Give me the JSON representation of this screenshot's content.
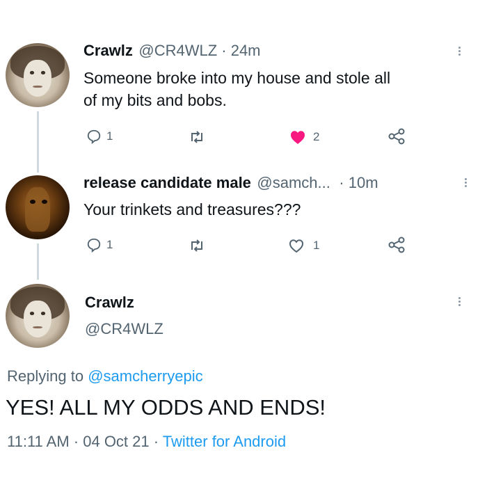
{
  "tweet1": {
    "name": "Crawlz",
    "handle_time": "@CR4WLZ · 24m",
    "text_line1": "Someone broke into my house and stole all",
    "text_line2": "of my bits and bobs.",
    "reply_count": "1",
    "like_count": "2",
    "liked": true
  },
  "tweet2": {
    "name": "release candidate male",
    "handle": "@samch...",
    "time": "· 10m",
    "text": "Your trinkets and treasures???",
    "reply_count": "1",
    "like_count": "1",
    "liked": false
  },
  "main_tweet": {
    "name": "Crawlz",
    "handle": "@CR4WLZ",
    "replying_prefix": "Replying to",
    "replying_handle": "@samcherryepic",
    "text": "YES! ALL MY ODDS AND ENDS!",
    "timestamp": "11:11 AM · 04 Oct 21 ·",
    "source": "Twitter for Android"
  },
  "colors": {
    "like_red": "#f91880",
    "link_blue": "#1d9bf0",
    "muted": "#536471"
  },
  "icons": [
    "reply-icon",
    "retweet-icon",
    "heart-icon",
    "share-icon",
    "more-icon"
  ]
}
